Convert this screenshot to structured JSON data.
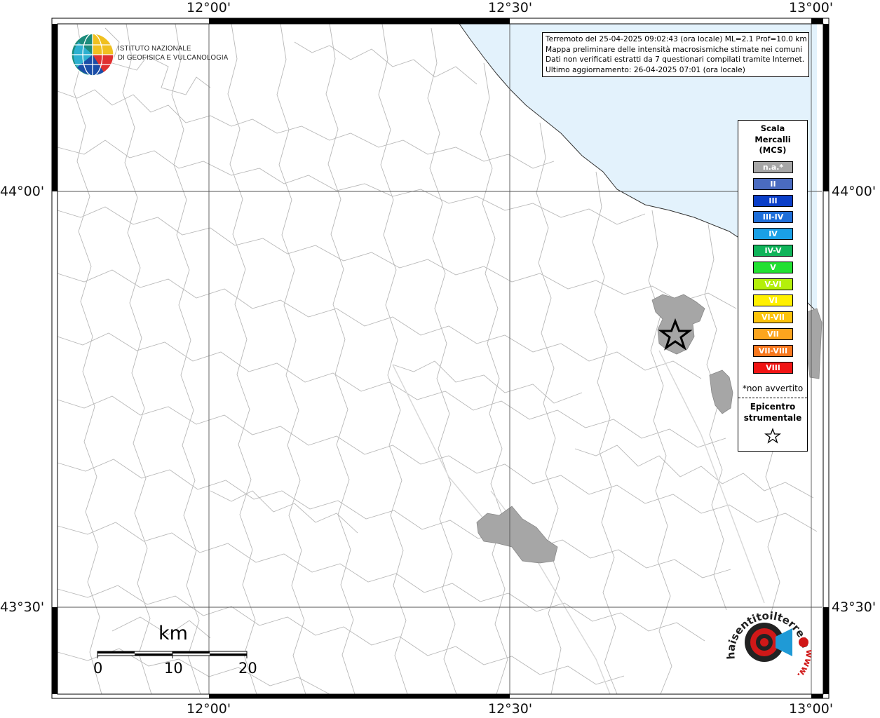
{
  "map": {
    "colors": {
      "sea": "#e3f2fc",
      "land": "#ffffff",
      "boundary": "#b8b8b8",
      "affected": "#a6a6a6",
      "frame": "#000000"
    },
    "longitude_labels": [
      "12°00'",
      "12°30'",
      "13°00'"
    ],
    "latitude_labels": [
      "44°00'",
      "43°30'"
    ]
  },
  "info": {
    "line1": "Terremoto del 25-04-2025 09:02:43 (ora locale) ML=2.1 Prof=10.0 km",
    "line2": "Mappa preliminare delle intensità macrosismiche stimate nei comuni",
    "line3": "Dati non verificati estratti da 7 questionari compilati tramite Internet.",
    "line4": "Ultimo aggiornamento: 26-04-2025 07:01 (ora locale)"
  },
  "logo": {
    "line1": "ISTITUTO NAZIONALE",
    "line2": "DI GEOFISICA E VULCANOLOGIA"
  },
  "legend": {
    "title1": "Scala",
    "title2": "Mercalli",
    "title3": "(MCS)",
    "items": [
      {
        "label": "n.a.*",
        "color": "#a6a6a6"
      },
      {
        "label": "II",
        "color": "#4a6bc0"
      },
      {
        "label": "III",
        "color": "#0a3ec8"
      },
      {
        "label": "III-IV",
        "color": "#1e6fd9"
      },
      {
        "label": "IV",
        "color": "#1aa0e6"
      },
      {
        "label": "IV-V",
        "color": "#0fb45a"
      },
      {
        "label": "V",
        "color": "#22e033"
      },
      {
        "label": "V-VI",
        "color": "#b4f00a"
      },
      {
        "label": "VI",
        "color": "#fff000"
      },
      {
        "label": "VI-VII",
        "color": "#fcc30a"
      },
      {
        "label": "VII",
        "color": "#fca51e"
      },
      {
        "label": "VII-VIII",
        "color": "#f8781e"
      },
      {
        "label": "VIII",
        "color": "#f01414"
      }
    ],
    "non_avvertito": "*non avvertito",
    "epicentro1": "Epicentro",
    "epicentro2": "strumentale"
  },
  "scalebar": {
    "unit": "km",
    "ticks": [
      "0",
      "10",
      "20"
    ]
  },
  "hsit_logo": {
    "text": "haisentitoilterremoto.it",
    "www": "www."
  }
}
